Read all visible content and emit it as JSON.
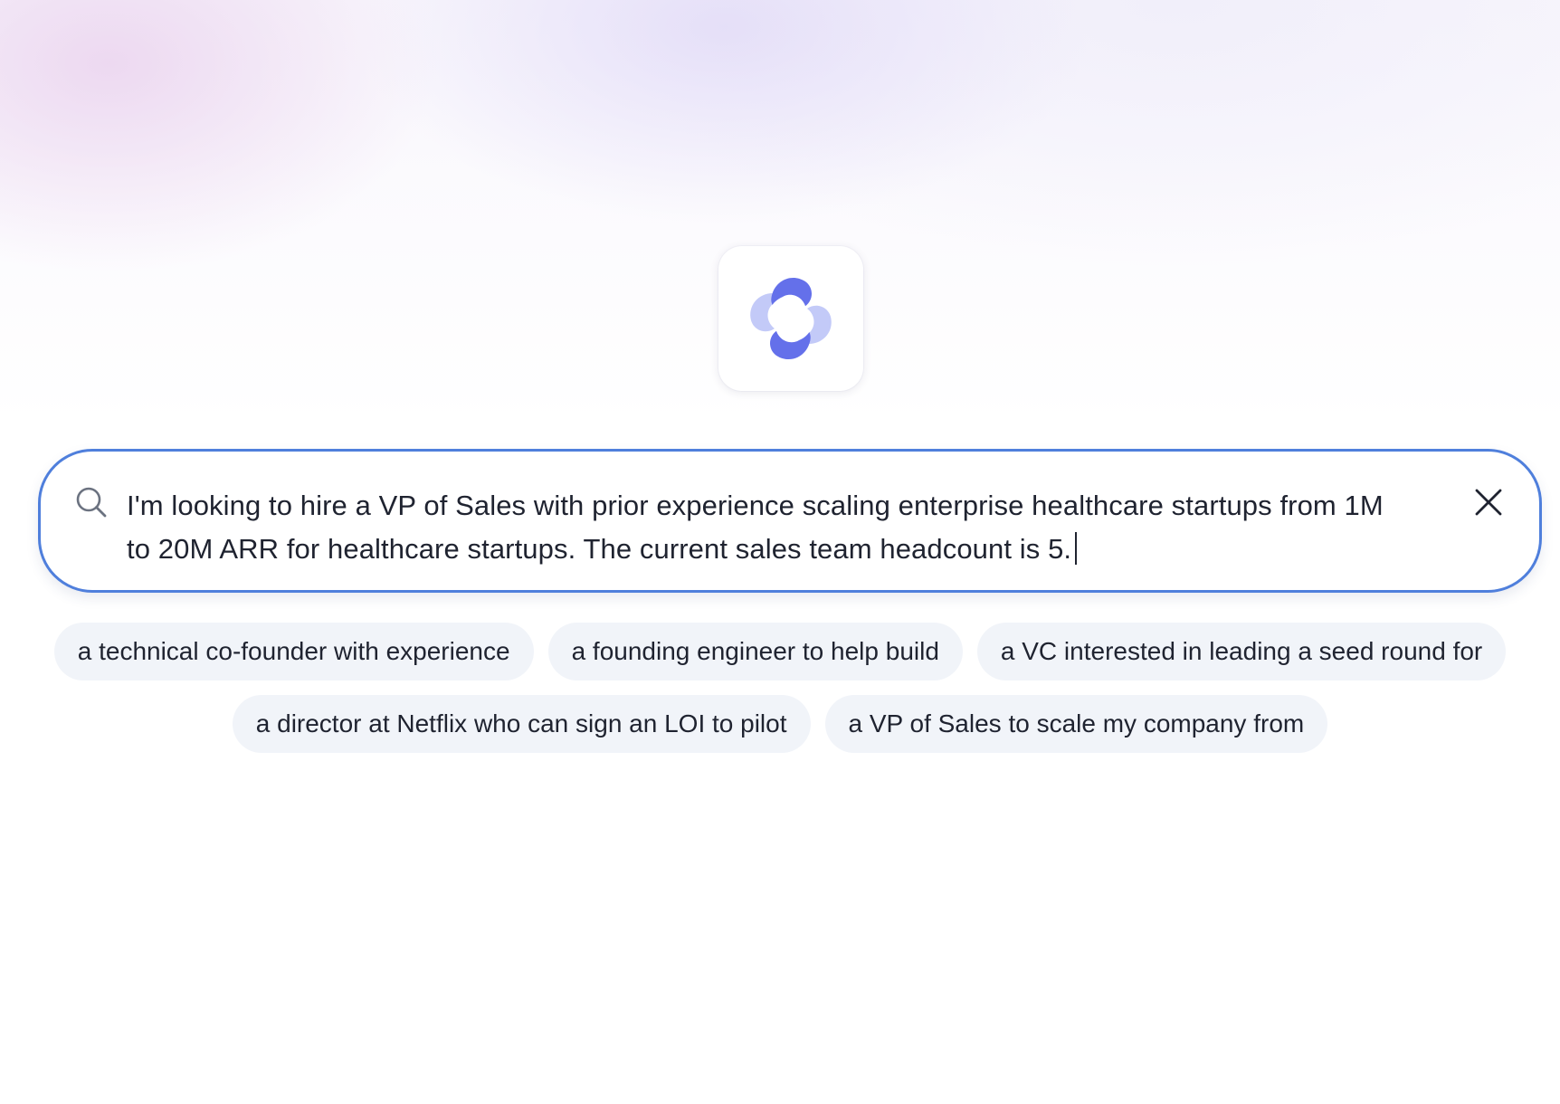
{
  "app": {
    "logo_icon": "app-logo-icon"
  },
  "search": {
    "icon": "search-icon",
    "value_line1": "I'm looking to hire a VP of Sales with prior experience scaling enterprise healthcare startups from 1M",
    "value_line2": "to 20M ARR for healthcare startups. The current sales team headcount is 5.",
    "clear_icon": "close-icon",
    "border_color": "#4f7fdc"
  },
  "suggestions": {
    "row1": [
      "a technical co-founder with experience",
      "a founding engineer to help build",
      "a VC interested in leading a seed round for"
    ],
    "row2": [
      "a director at Netflix who can sign an LOI to pilot",
      "a VP of Sales to scale my company from"
    ]
  },
  "colors": {
    "accent": "#4f7fdc",
    "logo_dark": "#6470ea",
    "logo_light": "#c3caf8",
    "chip_bg": "#f1f4f9"
  }
}
